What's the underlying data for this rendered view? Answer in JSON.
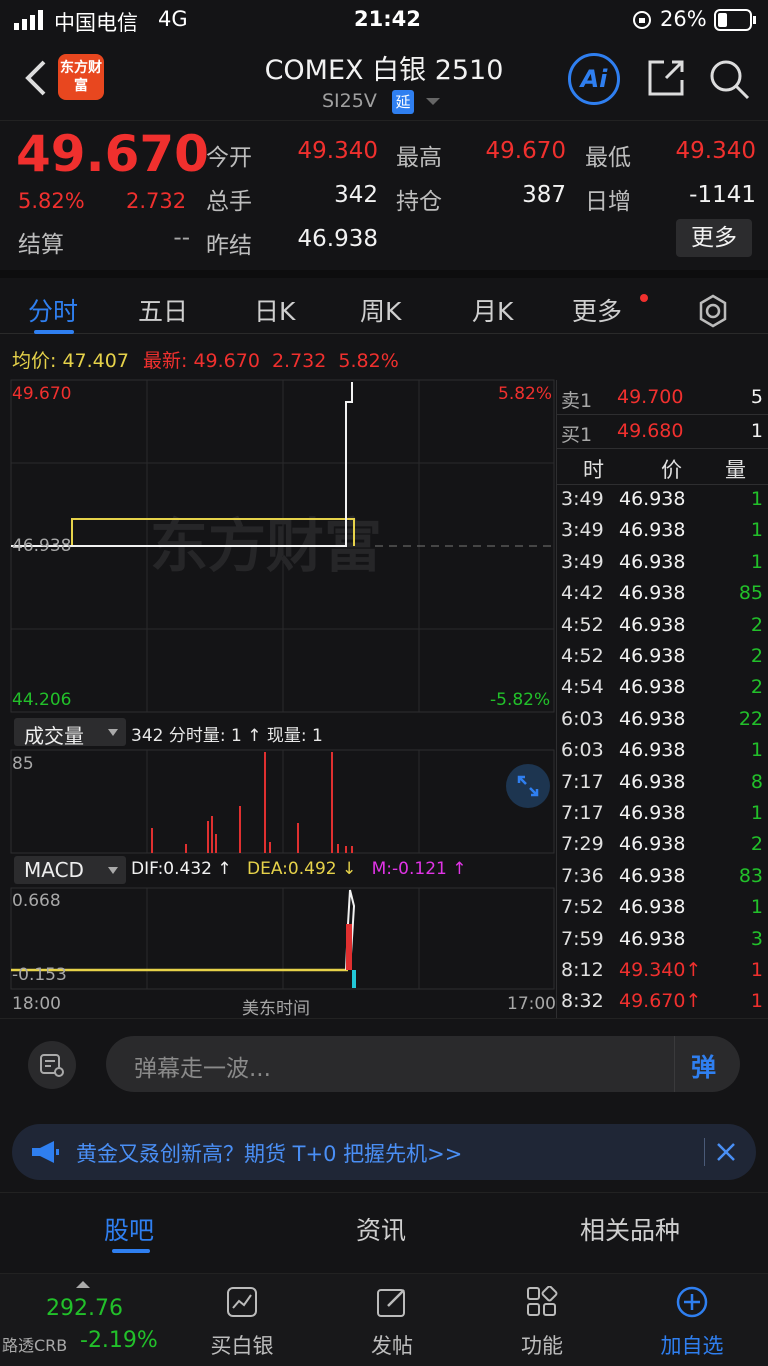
{
  "status_bar": {
    "carrier": "中国电信",
    "network": "4G",
    "time": "21:42",
    "battery": "26%"
  },
  "header": {
    "logo_text": "东方财富",
    "title": "COMEX 白银 2510",
    "code": "SI25V",
    "delay_badge": "延",
    "ai_label": "Ai"
  },
  "quote": {
    "price": "49.670",
    "change_pct": "5.82%",
    "change": "2.732",
    "settle_label": "结算",
    "settle_value": "--",
    "fields": [
      {
        "label": "今开",
        "value": "49.340"
      },
      {
        "label": "最高",
        "value": "49.670"
      },
      {
        "label": "最低",
        "value": "49.340"
      },
      {
        "label": "总手",
        "value": "342"
      },
      {
        "label": "持仓",
        "value": "387"
      },
      {
        "label": "日增",
        "value": "-1141"
      },
      {
        "label": "昨结",
        "value": "46.938"
      }
    ],
    "more_button": "更多"
  },
  "tabs": [
    "分时",
    "五日",
    "日K",
    "周K",
    "月K",
    "更多"
  ],
  "chart": {
    "avg_label": "均价:",
    "avg_value": "47.407",
    "latest_label": "最新:",
    "latest_value": "49.670",
    "latest_change": "2.732",
    "latest_pct": "5.82%",
    "y_top": "49.670",
    "y_mid": "46.938",
    "y_bottom": "44.206",
    "pct_top": "5.82%",
    "pct_bottom": "-5.82%",
    "watermark": "东方财富",
    "volume_selector": "成交量",
    "volume_summary": "342 分时量: 1 ↑ 现量: 1",
    "volume_max": "85",
    "macd_selector": "MACD",
    "dif": "DIF:0.432 ↑",
    "dea": "DEA:0.492 ↓",
    "m": "M:-0.121 ↑",
    "macd_top": "0.668",
    "macd_bottom": "-0.153",
    "x_start": "18:00",
    "x_mid": "美东时间",
    "x_end": "17:00"
  },
  "order_book": {
    "sell": {
      "label": "卖1",
      "price": "49.700",
      "qty": "5"
    },
    "buy": {
      "label": "买1",
      "price": "49.680",
      "qty": "1"
    },
    "headers": [
      "时",
      "价",
      "量"
    ],
    "trades": [
      {
        "t": "3:49",
        "p": "46.938",
        "q": "1",
        "up": false
      },
      {
        "t": "3:49",
        "p": "46.938",
        "q": "1",
        "up": false
      },
      {
        "t": "3:49",
        "p": "46.938",
        "q": "1",
        "up": false
      },
      {
        "t": "4:42",
        "p": "46.938",
        "q": "85",
        "up": false
      },
      {
        "t": "4:52",
        "p": "46.938",
        "q": "2",
        "up": false
      },
      {
        "t": "4:52",
        "p": "46.938",
        "q": "2",
        "up": false
      },
      {
        "t": "4:54",
        "p": "46.938",
        "q": "2",
        "up": false
      },
      {
        "t": "6:03",
        "p": "46.938",
        "q": "22",
        "up": false
      },
      {
        "t": "6:03",
        "p": "46.938",
        "q": "1",
        "up": false
      },
      {
        "t": "7:17",
        "p": "46.938",
        "q": "8",
        "up": false
      },
      {
        "t": "7:17",
        "p": "46.938",
        "q": "1",
        "up": false
      },
      {
        "t": "7:29",
        "p": "46.938",
        "q": "2",
        "up": false
      },
      {
        "t": "7:36",
        "p": "46.938",
        "q": "83",
        "up": false
      },
      {
        "t": "7:52",
        "p": "46.938",
        "q": "1",
        "up": false
      },
      {
        "t": "7:59",
        "p": "46.938",
        "q": "3",
        "up": false
      },
      {
        "t": "8:12",
        "p": "49.340↑",
        "q": "1",
        "up": true
      },
      {
        "t": "8:32",
        "p": "49.670↑",
        "q": "1",
        "up": true
      }
    ]
  },
  "comment": {
    "placeholder": "弹幕走一波...",
    "danmu_button": "弹"
  },
  "ad": {
    "text": "黄金又叒创新高？期货 T+0 把握先机>>"
  },
  "subtabs": [
    "股吧",
    "资讯",
    "相关品种"
  ],
  "bottom_nav": {
    "index_value": "292.76",
    "index_name": "路透CRB",
    "index_pct": "-2.19%",
    "items": [
      "买白银",
      "发帖",
      "功能",
      "加自选"
    ]
  }
}
